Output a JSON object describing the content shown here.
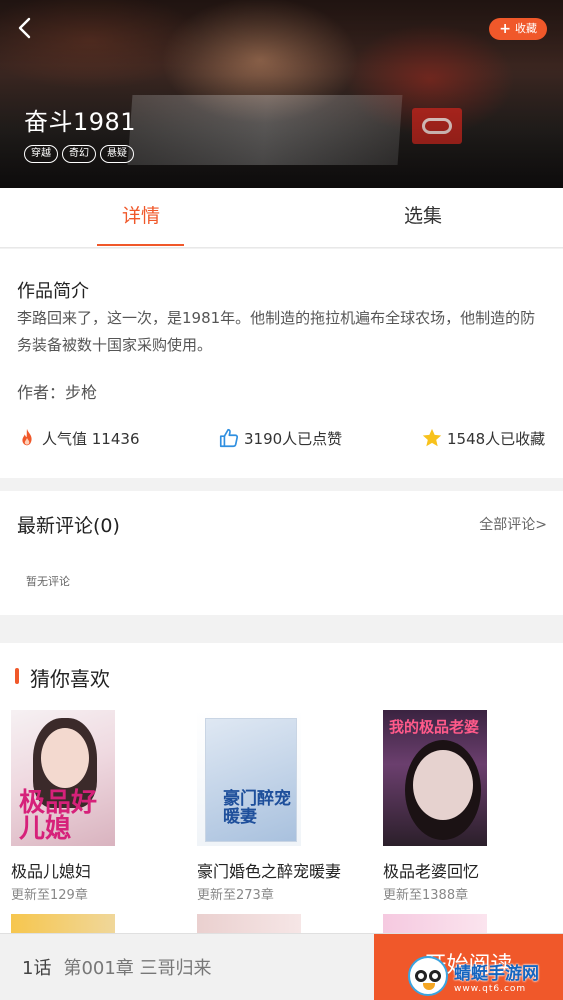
{
  "hero": {
    "title": "奋斗1981",
    "favorite_label": "收藏",
    "tags": [
      "穿越",
      "奇幻",
      "悬疑"
    ]
  },
  "tabs": [
    {
      "label": "详情",
      "active": true
    },
    {
      "label": "选集",
      "active": false
    }
  ],
  "details": {
    "heading": "作品简介",
    "summary": "李路回来了，这一次，是1981年。他制造的拖拉机遍布全球农场，他制造的防务装备被数十国家采购使用。",
    "author": "作者：步枪",
    "stats": {
      "popularity": "人气值 11436",
      "likes": "3190人已点赞",
      "favorites": "1548人已收藏"
    }
  },
  "comments": {
    "title": "最新评论(0)",
    "all_link": "全部评论>",
    "empty_text": "暂无评论"
  },
  "recommendations": {
    "title": "猜你喜欢",
    "items": [
      {
        "name": "极品儿媳妇",
        "sub": "更新至129章",
        "cover_text": "极品好儿媳"
      },
      {
        "name": "豪门婚色之醉宠暖妻",
        "sub": "更新至273章",
        "cover_text": "豪门醉宠暖妻"
      },
      {
        "name": "极品老婆回忆",
        "sub": "更新至1388章",
        "cover_text": "我的极品老婆"
      }
    ]
  },
  "bottom": {
    "episode_num": "1话",
    "episode_title": "第001章 三哥归来",
    "start_label": "开始阅读"
  },
  "watermark": {
    "name": "蜻蜓手游网",
    "url": "www.qt6.com"
  },
  "colors": {
    "accent": "#f0582a",
    "like_blue": "#2f8fe0",
    "star_yellow": "#f8c21c",
    "fire_orange": "#f0582a"
  }
}
